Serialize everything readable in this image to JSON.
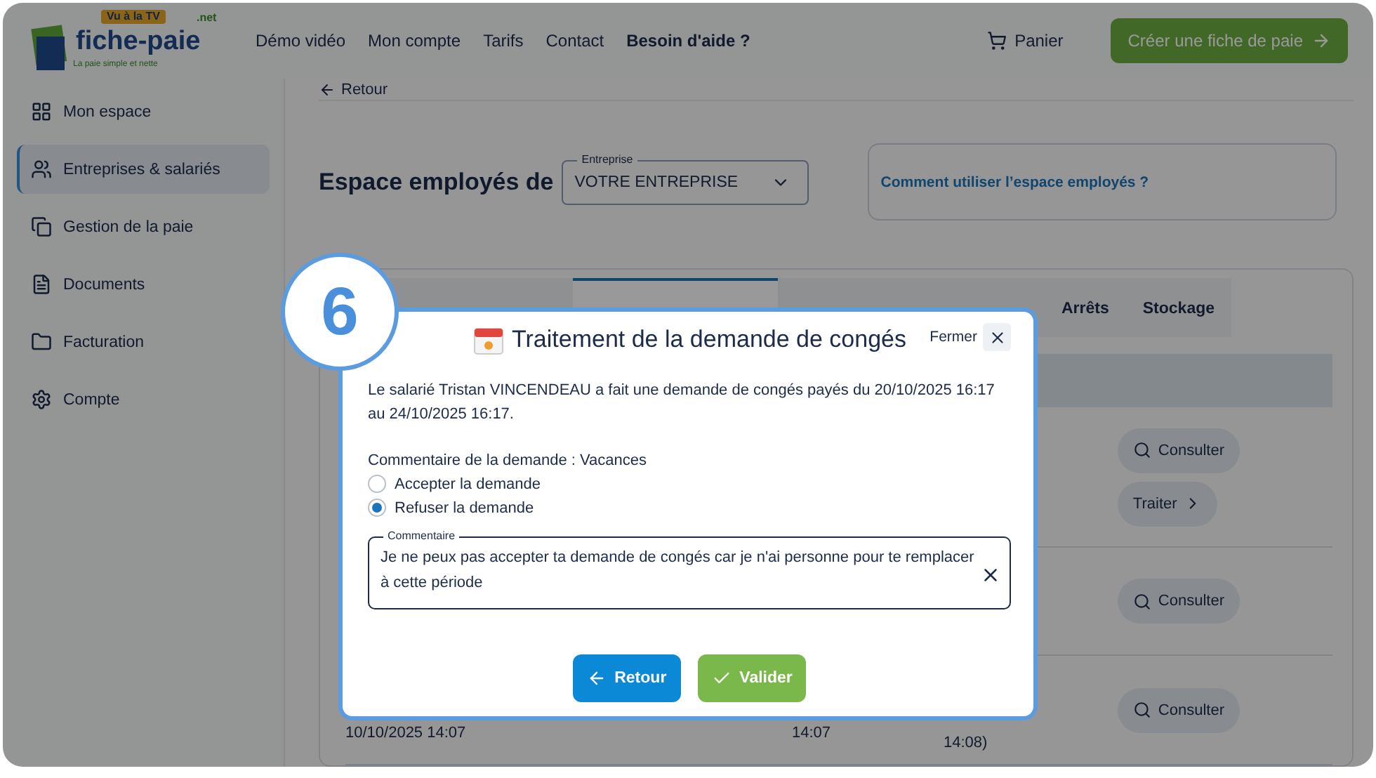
{
  "header": {
    "logo": {
      "badge": "Vu à la TV",
      "name": "fiche-paie",
      "suffix": ".net",
      "tagline": "La paie simple et nette"
    },
    "nav": [
      {
        "label": "Démo vidéo",
        "bold": false
      },
      {
        "label": "Mon compte",
        "bold": false
      },
      {
        "label": "Tarifs",
        "bold": false
      },
      {
        "label": "Contact",
        "bold": false
      },
      {
        "label": "Besoin d'aide ?",
        "bold": true
      }
    ],
    "cart": "Panier",
    "cta": "Créer une fiche de paie"
  },
  "sidebar": {
    "items": [
      {
        "label": "Mon espace",
        "selected": false
      },
      {
        "label": "Entreprises & salariés",
        "selected": true
      },
      {
        "label": "Gestion de la paie",
        "selected": false
      },
      {
        "label": "Documents",
        "selected": false
      },
      {
        "label": "Facturation",
        "selected": false
      },
      {
        "label": "Compte",
        "selected": false
      }
    ]
  },
  "back_link": "Retour",
  "page": {
    "title": "Espace employés de",
    "company_field": {
      "label": "Entreprise",
      "value": "VOTRE ENTREPRISE"
    },
    "help_link": "Comment utiliser l’espace employés ?"
  },
  "tabs": [
    {
      "selected": false
    },
    {
      "selected": false
    },
    {
      "selected": true
    },
    {
      "selected": false
    },
    {
      "selected": false
    },
    {
      "label": "Arrêts",
      "selected": false
    },
    {
      "label": "Stockage",
      "selected": false
    }
  ],
  "rows": [
    {
      "cells": [],
      "actions": [
        "Consulter",
        "Traiter"
      ]
    },
    {
      "cells": [],
      "actions": [
        "Consulter"
      ]
    },
    {
      "cells": [
        "10/10/2025 14:07",
        "14:07",
        "14:08)"
      ],
      "actions": [
        "Consulter"
      ]
    }
  ],
  "step_badge": "6",
  "modal": {
    "title": "Traitement de la demande de congés",
    "close_label": "Fermer",
    "message": "Le salarié Tristan VINCENDEAU a fait une demande de congés payés du 20/10/2025 16:17 au 24/10/2025 16:17.",
    "request_comment": "Commentaire de la demande : Vacances",
    "options": [
      {
        "label": "Accepter la demande",
        "selected": false
      },
      {
        "label": "Refuser la demande",
        "selected": true
      }
    ],
    "comment": {
      "label": "Commentaire",
      "value": "Je ne peux pas accepter ta demande de congés car je n'ai personne pour te remplacer à cette période"
    },
    "buttons": [
      {
        "label": "Retour",
        "kind": "back"
      },
      {
        "label": "Valider",
        "kind": "confirm"
      }
    ]
  }
}
